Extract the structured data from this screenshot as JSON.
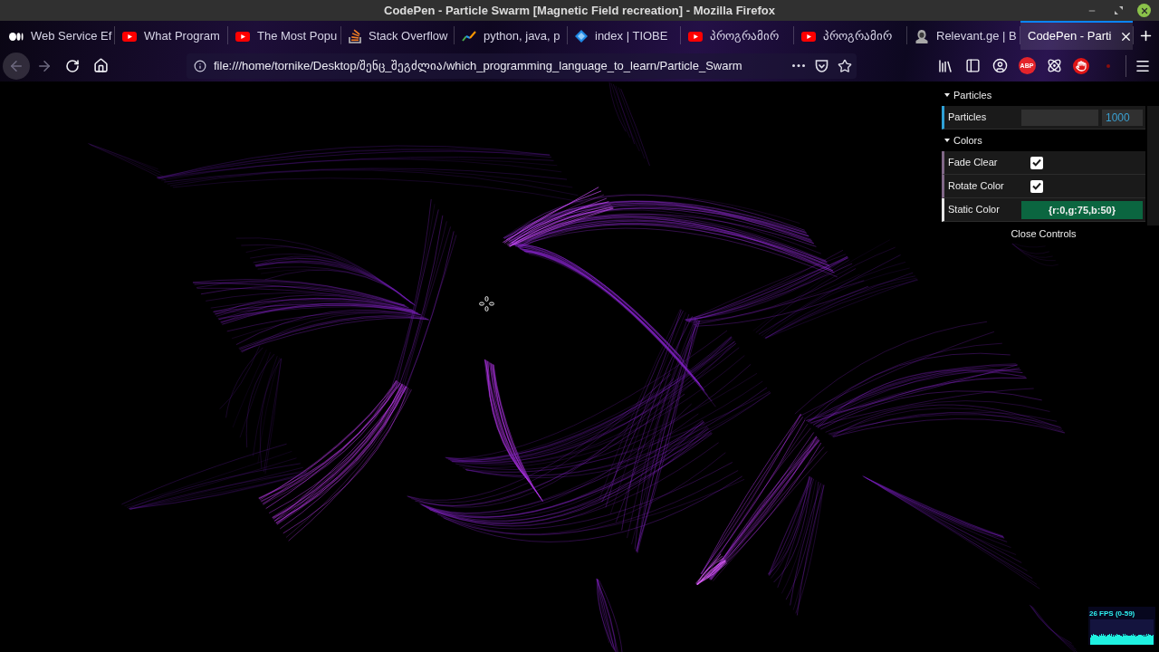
{
  "window": {
    "title": "CodePen - Particle Swarm [Magnetic Field recreation] - Mozilla Firefox"
  },
  "tabs": [
    {
      "label": "Web Service Ef",
      "kind": "dots",
      "selected": false
    },
    {
      "label": "What Program",
      "kind": "video",
      "selected": false
    },
    {
      "label": "The Most Popu",
      "kind": "video",
      "selected": false
    },
    {
      "label": "Stack Overflow",
      "kind": "stack",
      "selected": false
    },
    {
      "label": "python, java, p",
      "kind": "chart",
      "selected": false
    },
    {
      "label": "index | TIOBE",
      "kind": "diamond",
      "selected": false
    },
    {
      "label": "პროგრამირ",
      "kind": "video",
      "selected": false
    },
    {
      "label": "პროგრამირ",
      "kind": "video",
      "selected": false
    },
    {
      "label": "Relevant.ge | B",
      "kind": "person",
      "selected": false
    },
    {
      "label": "CodePen - Parti",
      "kind": "plain",
      "selected": true
    }
  ],
  "nav_buttons": [
    {
      "kind": "back",
      "disabled": true,
      "hovered": true
    },
    {
      "kind": "forward",
      "disabled": true,
      "hovered": false
    },
    {
      "kind": "reload",
      "disabled": false,
      "hovered": false
    },
    {
      "kind": "home",
      "disabled": false,
      "hovered": false
    }
  ],
  "address_bar": {
    "url": "file:///home/tornike/Desktop/შენც_შეგძლია/which_programming_language_to_learn/Particle_Swarm"
  },
  "toolbar_buttons": [
    {
      "kind": "library"
    },
    {
      "kind": "sidebar"
    },
    {
      "kind": "account"
    },
    {
      "kind": "extension",
      "label": "ABP"
    },
    {
      "kind": "atom"
    },
    {
      "kind": "hand"
    },
    {
      "kind": "dot"
    },
    {
      "kind": "menu"
    }
  ],
  "controls": {
    "folders": [
      {
        "title": "Particles",
        "expanded": true,
        "rows": [
          {
            "kind": "number",
            "label": "Particles",
            "value": "1000"
          }
        ]
      },
      {
        "title": "Colors",
        "expanded": true,
        "rows": [
          {
            "kind": "boolean",
            "label": "Fade Clear",
            "checked": true
          },
          {
            "kind": "boolean",
            "label": "Rotate Color",
            "checked": true
          },
          {
            "kind": "color",
            "label": "Static Color",
            "value": "{r:0,g:75,b:50}",
            "color": "#0b6640"
          }
        ]
      }
    ],
    "close_label": "Close Controls"
  },
  "fps_meter": {
    "reading": "26 FPS (0-59)"
  }
}
